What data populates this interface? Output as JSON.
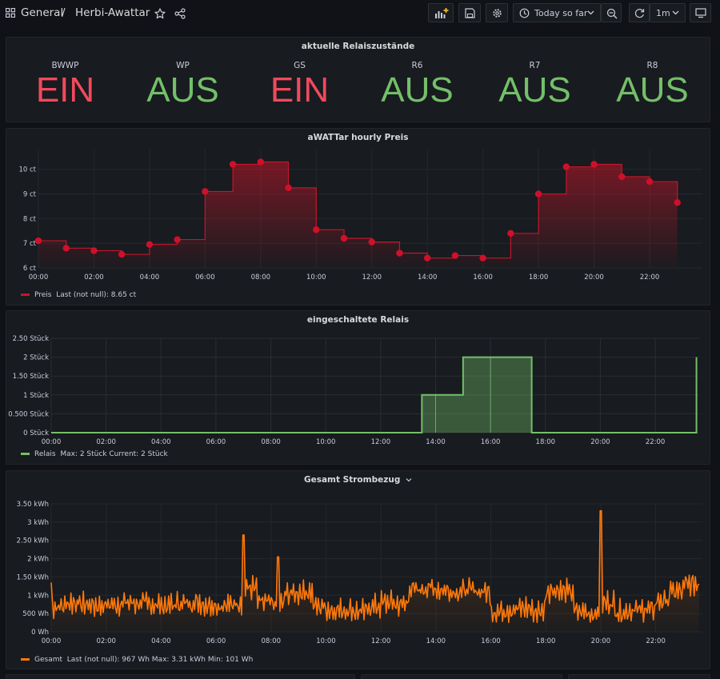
{
  "breadcrumb": {
    "folder": "General",
    "separator": "/",
    "dashboard": "Herbi-Awattar"
  },
  "toolbar": {
    "time_range": "Today so far",
    "refresh_interval": "1m"
  },
  "relay_panel": {
    "title": "aktuelle Relaiszustände",
    "stats": [
      {
        "name": "BWWP",
        "value": "EIN",
        "color": "#f2495c"
      },
      {
        "name": "WP",
        "value": "AUS",
        "color": "#73bf69"
      },
      {
        "name": "GS",
        "value": "EIN",
        "color": "#f2495c"
      },
      {
        "name": "R6",
        "value": "AUS",
        "color": "#73bf69"
      },
      {
        "name": "R7",
        "value": "AUS",
        "color": "#73bf69"
      },
      {
        "name": "R8",
        "value": "AUS",
        "color": "#73bf69"
      }
    ]
  },
  "price_panel": {
    "title": "aWATTar hourly Preis",
    "legend": {
      "series": "Preis",
      "stats": "Last (not null): 8.65 ct"
    }
  },
  "relais_panel": {
    "title": "eingeschaltete Relais",
    "legend": {
      "series": "Relais",
      "stats": "Max: 2 Stück  Current: 2 Stück"
    }
  },
  "power_panel": {
    "title": "Gesamt Strombezug",
    "legend": {
      "series": "Gesamt",
      "stats": "Last (not null): 967 Wh  Max: 3.31 kWh  Min: 101 Wh"
    }
  },
  "chart_data": [
    {
      "type": "line",
      "style": "stepped-area-with-points",
      "title": "aWATTar hourly Preis",
      "series": [
        {
          "name": "Preis",
          "color": "#c4162a",
          "x": [
            "00:00",
            "01:00",
            "02:00",
            "03:00",
            "04:00",
            "05:00",
            "06:00",
            "07:00",
            "08:00",
            "09:00",
            "10:00",
            "11:00",
            "12:00",
            "13:00",
            "14:00",
            "15:00",
            "16:00",
            "17:00",
            "18:00",
            "19:00",
            "20:00",
            "21:00",
            "22:00",
            "23:00"
          ],
          "values": [
            7.1,
            6.8,
            6.7,
            6.55,
            6.95,
            7.15,
            9.1,
            10.2,
            10.3,
            9.25,
            7.55,
            7.2,
            7.05,
            6.6,
            6.4,
            6.5,
            6.4,
            7.4,
            9.0,
            10.1,
            10.2,
            9.7,
            9.5,
            8.65
          ]
        }
      ],
      "x_ticks": [
        "00:00",
        "02:00",
        "04:00",
        "06:00",
        "08:00",
        "10:00",
        "12:00",
        "14:00",
        "16:00",
        "18:00",
        "20:00",
        "22:00"
      ],
      "y_ticks": [
        "6 ct",
        "7 ct",
        "8 ct",
        "9 ct",
        "10 ct"
      ],
      "ylim": [
        6,
        10.8
      ],
      "grid": true,
      "legend_position": "bottom-left"
    },
    {
      "type": "area",
      "style": "stepped",
      "title": "eingeschaltete Relais",
      "series": [
        {
          "name": "Relais",
          "color": "#73bf69",
          "points": [
            [
              "00:00",
              0
            ],
            [
              "13:30",
              0
            ],
            [
              "13:30",
              1
            ],
            [
              "15:00",
              1
            ],
            [
              "15:00",
              2
            ],
            [
              "17:30",
              2
            ],
            [
              "17:30",
              0
            ],
            [
              "23:30",
              0
            ],
            [
              "23:30",
              2
            ]
          ]
        }
      ],
      "x_ticks": [
        "00:00",
        "02:00",
        "04:00",
        "06:00",
        "08:00",
        "10:00",
        "12:00",
        "14:00",
        "16:00",
        "18:00",
        "20:00",
        "22:00"
      ],
      "y_ticks": [
        "0 Stück",
        "0.500 Stück",
        "1 Stück",
        "1.50 Stück",
        "2 Stück",
        "2.50 Stück"
      ],
      "ylim": [
        0,
        2.5
      ],
      "grid": true,
      "legend_position": "bottom-left"
    },
    {
      "type": "line",
      "title": "Gesamt Strombezug",
      "series": [
        {
          "name": "Gesamt",
          "color": "#ff780a",
          "levels_kwh": [
            [
              "00:00",
              0.7
            ],
            [
              "00:30",
              0.8
            ],
            [
              "01:00",
              0.75
            ],
            [
              "01:30",
              0.72
            ],
            [
              "02:00",
              0.75
            ],
            [
              "02:30",
              0.8
            ],
            [
              "03:00",
              0.78
            ],
            [
              "03:30",
              0.75
            ],
            [
              "04:00",
              0.72
            ],
            [
              "04:30",
              0.78
            ],
            [
              "05:00",
              0.8
            ],
            [
              "05:30",
              0.75
            ],
            [
              "06:00",
              0.7
            ],
            [
              "06:30",
              0.8
            ],
            [
              "07:00",
              1.2
            ],
            [
              "07:30",
              0.8
            ],
            [
              "08:00",
              0.75
            ],
            [
              "08:30",
              1.05
            ],
            [
              "09:00",
              1.1
            ],
            [
              "09:30",
              0.7
            ],
            [
              "10:00",
              0.6
            ],
            [
              "10:30",
              0.6
            ],
            [
              "11:00",
              0.55
            ],
            [
              "11:30",
              0.7
            ],
            [
              "12:00",
              0.8
            ],
            [
              "12:30",
              0.75
            ],
            [
              "13:00",
              1.15
            ],
            [
              "13:30",
              1.2
            ],
            [
              "14:00",
              1.15
            ],
            [
              "14:30",
              1.1
            ],
            [
              "15:00",
              1.15
            ],
            [
              "15:30",
              1.1
            ],
            [
              "16:00",
              0.55
            ],
            [
              "16:30",
              0.6
            ],
            [
              "17:00",
              0.65
            ],
            [
              "17:30",
              0.55
            ],
            [
              "18:00",
              1.15
            ],
            [
              "18:30",
              1.1
            ],
            [
              "19:00",
              0.55
            ],
            [
              "19:30",
              0.5
            ],
            [
              "20:00",
              0.8
            ],
            [
              "20:30",
              0.55
            ],
            [
              "21:00",
              0.6
            ],
            [
              "21:30",
              0.6
            ],
            [
              "22:00",
              0.85
            ],
            [
              "22:30",
              1.1
            ],
            [
              "23:00",
              1.3
            ],
            [
              "23:30",
              1.3
            ]
          ],
          "peaks_kwh": [
            [
              "00:00",
              1.35
            ],
            [
              "07:00",
              2.65
            ],
            [
              "08:15",
              2.05
            ],
            [
              "20:00",
              3.31
            ]
          ],
          "last": "967 Wh",
          "max": "3.31 kWh",
          "min": "101 Wh"
        }
      ],
      "x_ticks": [
        "00:00",
        "02:00",
        "04:00",
        "06:00",
        "08:00",
        "10:00",
        "12:00",
        "14:00",
        "16:00",
        "18:00",
        "20:00",
        "22:00"
      ],
      "y_ticks": [
        "0 Wh",
        "500 Wh",
        "1 kWh",
        "1.50 kWh",
        "2 kWh",
        "2.50 kWh",
        "3 kWh",
        "3.50 kWh"
      ],
      "ylim": [
        0,
        3.5
      ],
      "grid": true,
      "legend_position": "bottom-left"
    }
  ]
}
